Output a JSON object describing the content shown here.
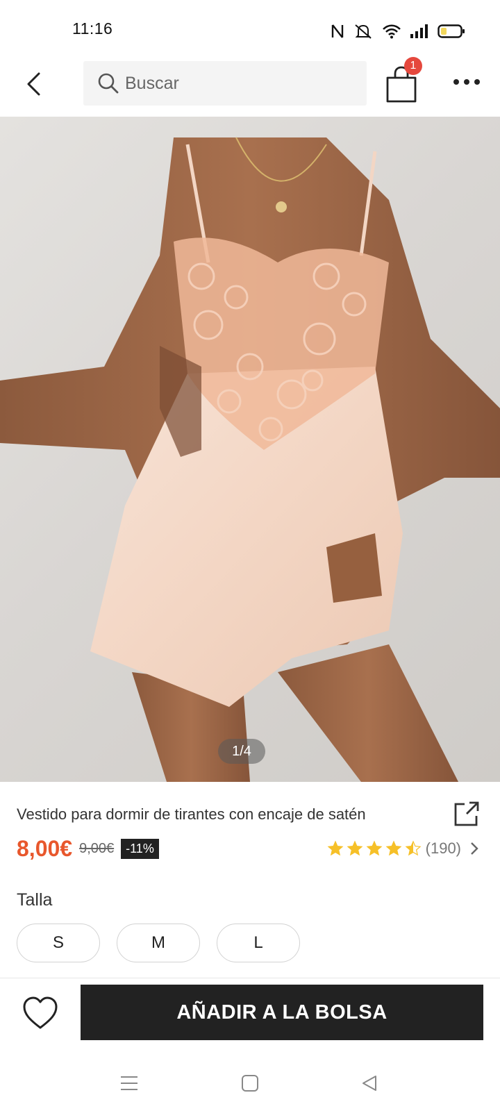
{
  "status_bar": {
    "time": "11:16",
    "battery_color": "#f2d75c"
  },
  "header": {
    "search": {
      "placeholder": "Buscar"
    },
    "cart": {
      "badge_count": "1",
      "badge_color": "#e5483d"
    }
  },
  "gallery": {
    "counter": "1/4"
  },
  "product": {
    "title": "Vestido para dormir de tirantes con encaje de satén",
    "price": "8,00€",
    "original_price": "9,00€",
    "discount": "-11%",
    "price_color": "#e8572c",
    "rating": 4.5,
    "review_count": "(190)",
    "star_color": "#f6c028"
  },
  "size": {
    "label": "Talla",
    "options": [
      "S",
      "M",
      "L"
    ]
  },
  "actions": {
    "add_to_bag": "AÑADIR A LA BOLSA"
  },
  "nav": {
    "icons": [
      "menu-icon",
      "home-square-icon",
      "back-triangle-icon"
    ]
  }
}
